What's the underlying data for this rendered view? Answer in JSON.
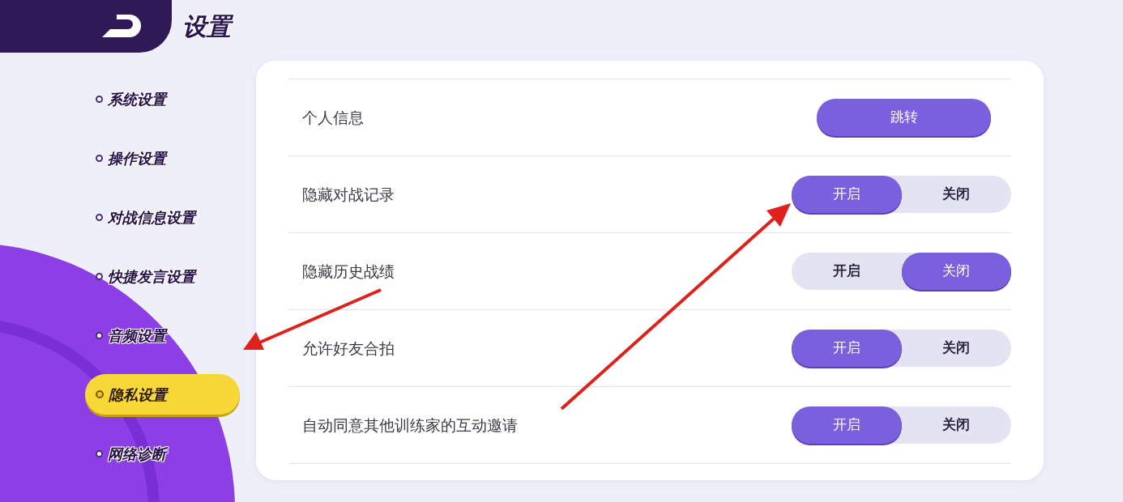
{
  "header": {
    "title": "设置"
  },
  "sidebar": {
    "items": [
      {
        "label": "系统设置",
        "selected": false
      },
      {
        "label": "操作设置",
        "selected": false
      },
      {
        "label": "对战信息设置",
        "selected": false
      },
      {
        "label": "快捷发言设置",
        "selected": false
      },
      {
        "label": "音频设置",
        "selected": false
      },
      {
        "label": "隐私设置",
        "selected": true
      },
      {
        "label": "网络诊断",
        "selected": false
      }
    ]
  },
  "settings": [
    {
      "kind": "link",
      "label": "个人信息",
      "button": "跳转"
    },
    {
      "kind": "toggle",
      "label": "隐藏对战记录",
      "options": [
        {
          "label": "开启",
          "selected": true
        },
        {
          "label": "关闭",
          "selected": false
        }
      ]
    },
    {
      "kind": "toggle",
      "label": "隐藏历史战绩",
      "options": [
        {
          "label": "开启",
          "selected": false
        },
        {
          "label": "关闭",
          "selected": true
        }
      ]
    },
    {
      "kind": "toggle",
      "label": "允许好友合拍",
      "options": [
        {
          "label": "开启",
          "selected": true
        },
        {
          "label": "关闭",
          "selected": false
        }
      ]
    },
    {
      "kind": "toggle",
      "label": "自动同意其他训练家的互动邀请",
      "options": [
        {
          "label": "开启",
          "selected": true
        },
        {
          "label": "关闭",
          "selected": false
        }
      ]
    }
  ]
}
